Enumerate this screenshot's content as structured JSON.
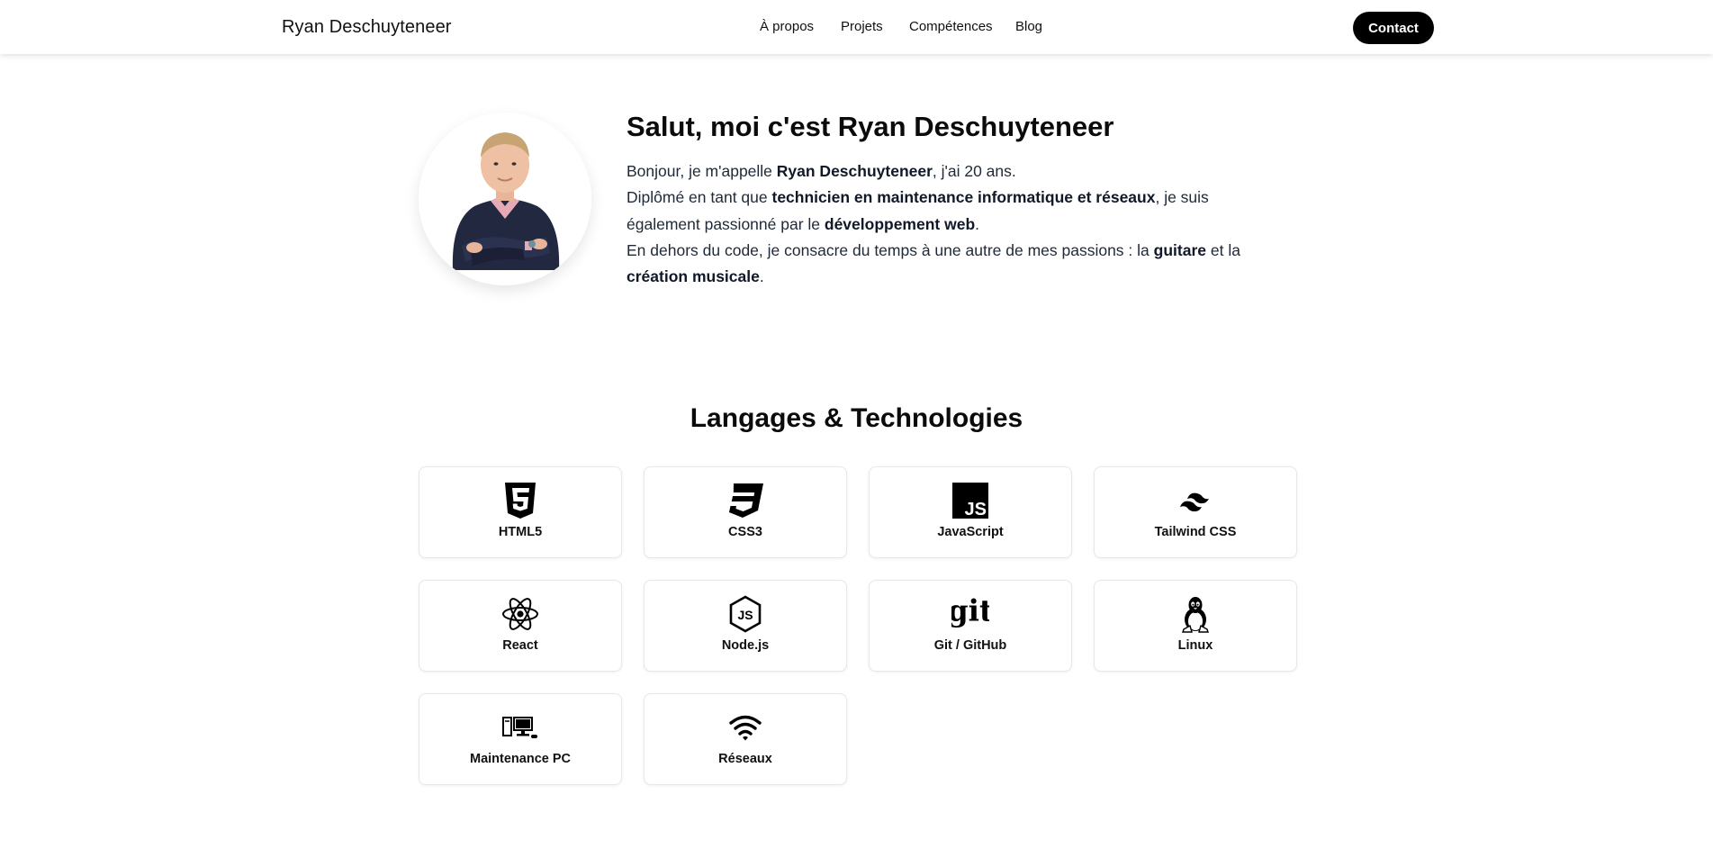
{
  "header": {
    "brand": "Ryan Deschuyteneer",
    "nav": [
      "À propos",
      "Projets",
      "Compétences",
      "Blog"
    ],
    "contact_label": "Contact"
  },
  "hero": {
    "title": "Salut, moi c'est Ryan Deschuyteneer",
    "avatar_alt": "Ryan Deschuyteneer",
    "p1_a": "Bonjour, je m'appelle ",
    "p1_b": "Ryan Deschuyteneer",
    "p1_c": ", j'ai 20 ans.",
    "p2_a": "Diplômé en tant que ",
    "p2_b": "technicien en maintenance informatique et réseaux",
    "p2_c": ", je suis également passionné par le ",
    "p2_d": "développement web",
    "p2_e": ".",
    "p3_a": "En dehors du code, je consacre du temps à une autre de mes passions : la ",
    "p3_b": "guitare",
    "p3_c": " et la ",
    "p3_d": "création musicale",
    "p3_e": "."
  },
  "skills": {
    "title": "Langages & Technologies",
    "items": [
      {
        "label": "HTML5",
        "icon": "html5-icon"
      },
      {
        "label": "CSS3",
        "icon": "css3-icon"
      },
      {
        "label": "JavaScript",
        "icon": "javascript-icon"
      },
      {
        "label": "Tailwind CSS",
        "icon": "tailwind-icon"
      },
      {
        "label": "React",
        "icon": "react-icon"
      },
      {
        "label": "Node.js",
        "icon": "nodejs-icon"
      },
      {
        "label": "Git / GitHub",
        "icon": "git-icon"
      },
      {
        "label": "Linux",
        "icon": "linux-icon"
      },
      {
        "label": "Maintenance PC",
        "icon": "computer-icon"
      },
      {
        "label": "Réseaux",
        "icon": "wifi-icon"
      }
    ]
  }
}
